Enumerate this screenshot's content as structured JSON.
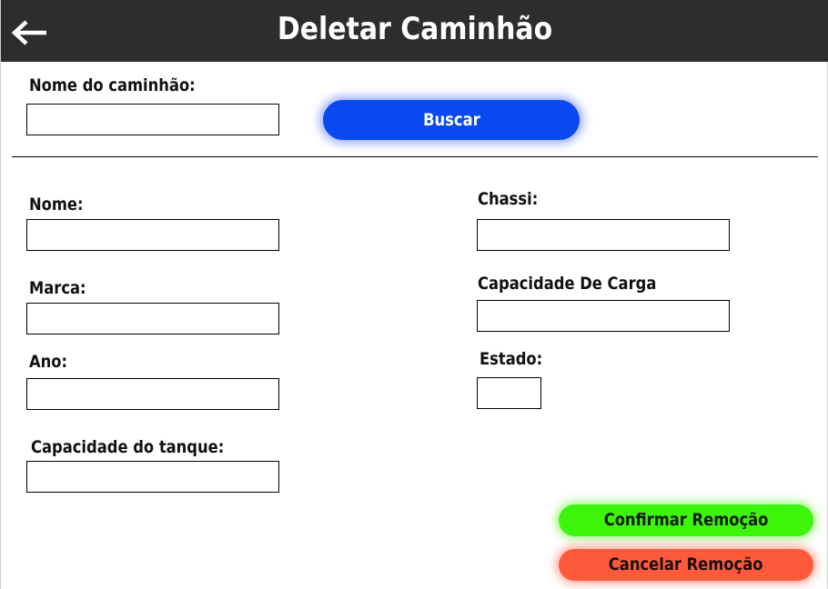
{
  "header": {
    "title": "Deletar Caminhão",
    "back_icon": "arrow-left-icon",
    "background_color": "#2d2d2d"
  },
  "search": {
    "label": "Nome do caminhão:",
    "value": "",
    "button_label": "Buscar",
    "button_color": "#0a48f0"
  },
  "form": {
    "left": {
      "nome_label": "Nome:",
      "nome_value": "",
      "marca_label": "Marca:",
      "marca_value": "",
      "ano_label": "Ano:",
      "ano_value": "",
      "capacidade_tanque_label": "Capacidade do tanque:",
      "capacidade_tanque_value": ""
    },
    "right": {
      "chassi_label": "Chassi:",
      "chassi_value": "",
      "capacidade_carga_label": "Capacidade De Carga",
      "capacidade_carga_value": "",
      "estado_label": "Estado:",
      "estado_value": ""
    }
  },
  "actions": {
    "confirm_label": "Confirmar Remoção",
    "confirm_color": "#3df50a",
    "cancel_label": "Cancelar Remoção",
    "cancel_color": "#ff5a3c"
  }
}
